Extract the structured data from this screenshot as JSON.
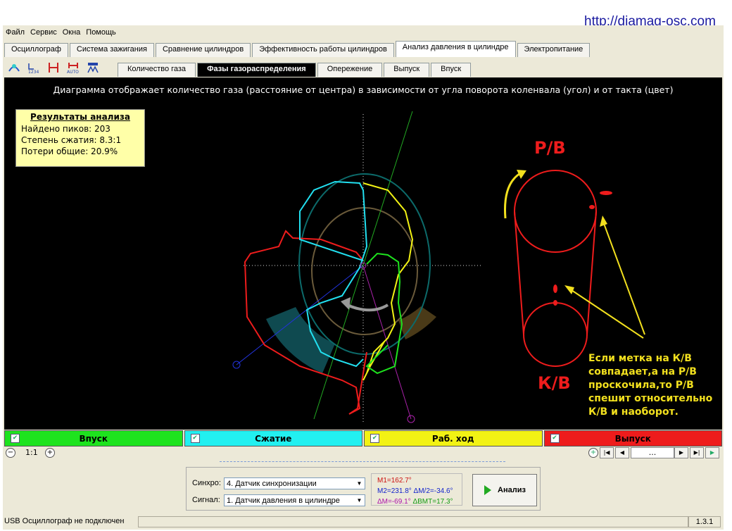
{
  "url": "http://diamag-osc.com",
  "menu": [
    "Файл",
    "Сервис",
    "Окна",
    "Помощь"
  ],
  "tabs": [
    "Осциллограф",
    "Система зажигания",
    "Сравнение цилиндров",
    "Эффективность работы цилиндров",
    "Анализ давления в цилиндре",
    "Электропитание"
  ],
  "active_tab": 4,
  "subtabs": [
    "Количество газа",
    "Фазы газораспределения",
    "Опережение",
    "Выпуск",
    "Впуск"
  ],
  "active_subtab": 1,
  "toolbar_icon_names": [
    "pressure-icon",
    "numbering-icon",
    "cursor-markers-icon",
    "auto-markers-icon",
    "zoom-fit-icon"
  ],
  "description": "Диаграмма отображает количество газа (расстояние от центра) в зависимости от угла поворота коленвала (угол) и от такта (цвет)",
  "results": {
    "title": "Результаты анализа",
    "peaks": "Найдено пиков: 203",
    "compression": "Степень сжатия: 8.3:1",
    "losses": "Потери общие: 20.9%"
  },
  "annotation": {
    "rv": "Р/В",
    "kv": "К/В",
    "note1": "Если метка на К/В",
    "note2": "совпадает,а на Р/В",
    "note3": "проскочила,то Р/В",
    "note4": "спешит относительно",
    "note5": "К/В и наоборот."
  },
  "legend": [
    {
      "label": "Впуск",
      "color": "#1ee31e"
    },
    {
      "label": "Сжатие",
      "color": "#22f0f0"
    },
    {
      "label": "Раб. ход",
      "color": "#f2f214"
    },
    {
      "label": "Выпуск",
      "color": "#ee1c1c"
    }
  ],
  "zoom": "1:1",
  "nav_text": "...",
  "synchro_label": "Синхро:",
  "synchro_value": "4.  Датчик синхронизации",
  "signal_label": "Сигнал:",
  "signal_value": "1.  Датчик давления в цилиндре",
  "measurements": {
    "m1": "M1=162.7°",
    "m2": "M2=231.8°",
    "dm2": "ΔM/2=-34.6°",
    "dm": "ΔM=-69.1°",
    "dvmt": "ΔВМТ=17.3°"
  },
  "analyze_label": "Анализ",
  "status_text": "USB Осциллограф не подключен",
  "version": "1.3.1"
}
